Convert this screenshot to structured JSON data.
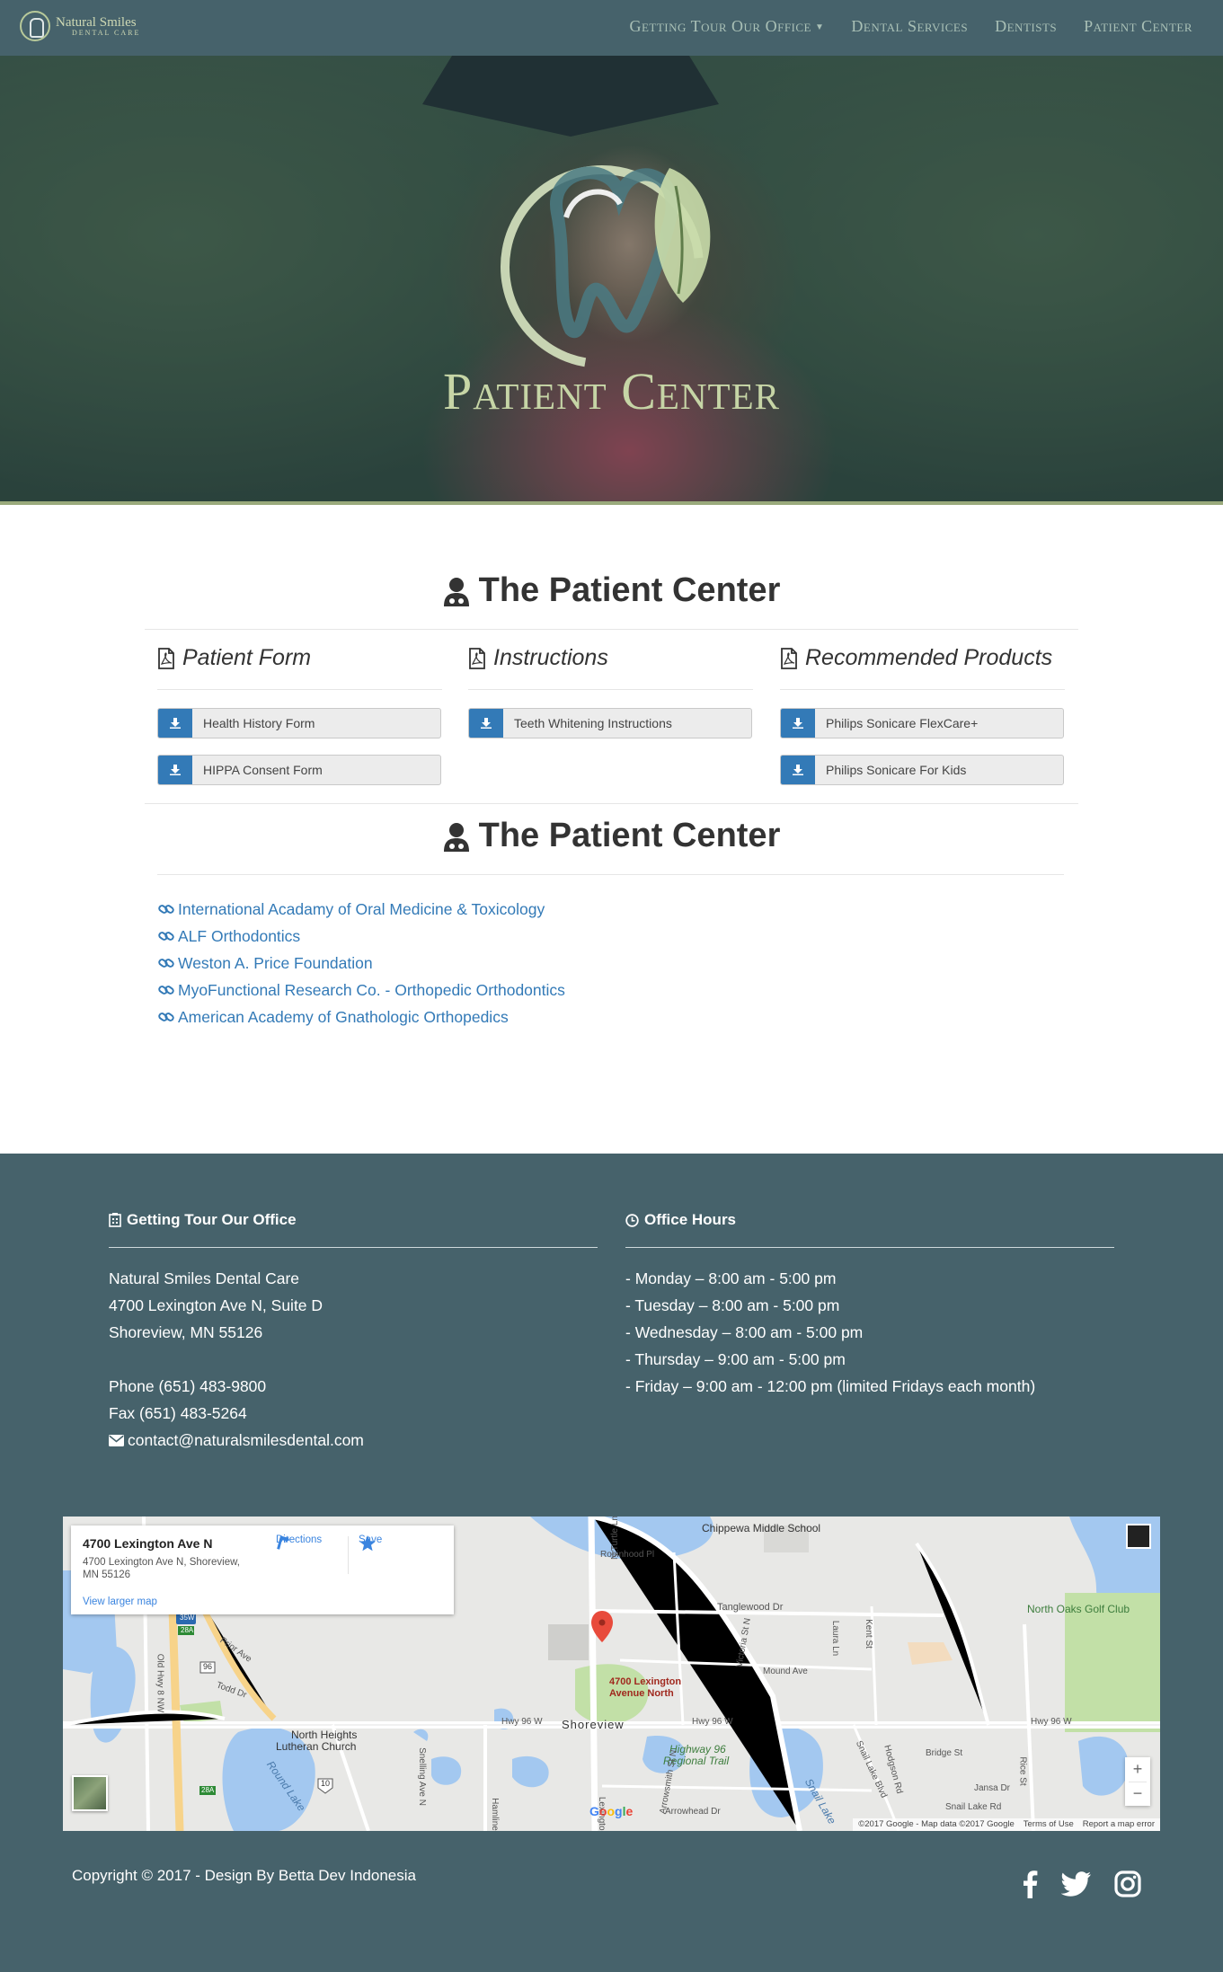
{
  "brand": {
    "name": "Natural Smiles",
    "sub": "DENTAL CARE"
  },
  "nav": {
    "items": [
      {
        "label": "Getting Tour Our Office",
        "dropdown": true
      },
      {
        "label": "Dental Services"
      },
      {
        "label": "Dentists"
      },
      {
        "label": "Patient Center"
      }
    ]
  },
  "hero": {
    "title": "Patient Center"
  },
  "patient_center": {
    "title": "The Patient Center",
    "columns": [
      {
        "title": "Patient Form",
        "icon": "pdf-icon",
        "buttons": [
          "Health History Form",
          "HIPPA Consent Form"
        ]
      },
      {
        "title": "Instructions",
        "icon": "pdf-icon",
        "buttons": [
          "Teeth Whitening Instructions"
        ]
      },
      {
        "title": "Recommended Products",
        "icon": "pdf-icon",
        "buttons": [
          "Philips Sonicare FlexCare+",
          "Philips Sonicare For Kids"
        ]
      }
    ]
  },
  "links_section": {
    "title": "The Patient Center",
    "links": [
      "International Acadamy of Oral Medicine & Toxicology",
      "ALF Orthodontics",
      "Weston A. Price Foundation",
      "MyoFunctional Research Co. - Orthopedic Orthodontics",
      "American Academy of Gnathologic Orthopedics"
    ]
  },
  "footer": {
    "office": {
      "heading": "Getting Tour Our Office",
      "name": "Natural Smiles Dental Care",
      "address1": "4700 Lexington Ave N, Suite D",
      "address2": "Shoreview, MN 55126",
      "phone": "Phone (651) 483-9800",
      "fax": "Fax (651) 483-5264",
      "email": "contact@naturalsmilesdental.com"
    },
    "hours": {
      "heading": "Office Hours",
      "lines": [
        "- Monday – 8:00 am - 5:00 pm",
        "- Tuesday – 8:00 am - 5:00 pm",
        "- Wednesday – 8:00 am - 5:00 pm",
        "- Thursday – 9:00 am - 5:00 pm",
        "- Friday – 9:00 am - 12:00 pm (limited Fridays each month)"
      ]
    },
    "map": {
      "card_title": "4700 Lexington Ave N",
      "card_address": "4700 Lexington Ave N, Shoreview, MN 55126",
      "view_larger": "View larger map",
      "directions": "Directions",
      "save": "Save",
      "marker_label_1": "4700 Lexington",
      "marker_label_2": "Avenue North",
      "places": {
        "school": "Chippewa Middle School",
        "robinhood": "Robinhood Pl",
        "tanglewood": "Tanglewood Dr",
        "golf": "North Oaks Golf Club",
        "shoreview": "Shoreview",
        "hwy96w_a": "Hwy 96 W",
        "hwy96w_b": "Hwy 96 W",
        "hwy96w_c": "Hwy 96 W",
        "trail1": "Highway 96",
        "trail2": "Regional Trail",
        "church1": "North Heights",
        "church2": "Lutheran Church",
        "round_lake": "Round Lake",
        "snail_lake": "Snail Lake",
        "mound": "Mound Ave",
        "victoria": "Victoria St N",
        "hodgson": "Hodgson Rd",
        "rice": "Rice St",
        "bridge": "Bridge St",
        "jansa": "Jansa Dr",
        "snail_lake_rd": "Snail Lake Rd",
        "snail_lake_blvd": "Snail Lake Blvd",
        "lexington": "Lexington",
        "turtle": "N Turtle Ln",
        "laura": "Laura Ln",
        "kent": "Kent St",
        "hamline": "Hamline",
        "arrowhead": "Arrowhead Dr",
        "arrowsmith": "Arrowsmith St N",
        "snelling": "Snelling Ave N",
        "old_hwy8": "Old Hwy 8 NW",
        "prior": "Prior Ave",
        "todd": "Todd Dr",
        "i35w": "35W",
        "exit28a_1": "28A",
        "exit28a_2": "28A",
        "rt96": "96",
        "rt10": "10"
      },
      "attribution": [
        "©2017 Google - Map data ©2017 Google",
        "Terms of Use",
        "Report a map error"
      ],
      "google": "Google"
    },
    "copyright": "Copyright © 2017 - Design By Betta Dev Indonesia",
    "social": [
      "facebook-icon",
      "twitter-icon",
      "instagram-icon"
    ]
  },
  "colors": {
    "nav_bg": "#46626b",
    "footer_bg": "#46626b",
    "accent_blue": "#337ab7",
    "hero_title": "#c6d5a6",
    "hero_border": "#9aaa7c"
  }
}
